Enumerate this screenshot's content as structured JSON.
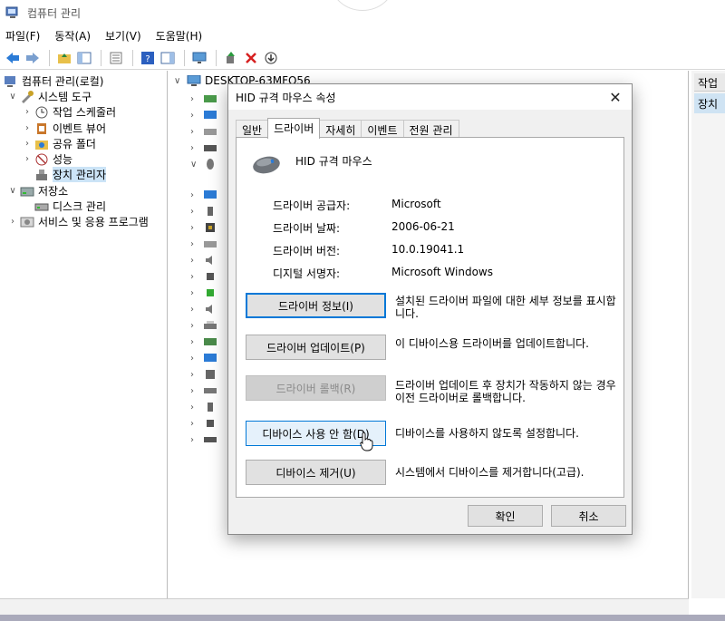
{
  "window": {
    "title": "컴퓨터 관리"
  },
  "menu": [
    "파일(F)",
    "동작(A)",
    "보기(V)",
    "도움말(H)"
  ],
  "tree": {
    "root": "컴퓨터 관리(로컬)",
    "system_tools": "시스템 도구",
    "task_scheduler": "작업 스케줄러",
    "event_viewer": "이벤트 뷰어",
    "shared_folders": "공유 폴더",
    "performance": "성능",
    "device_manager": "장치 관리자",
    "storage": "저장소",
    "disk_management": "디스크 관리",
    "services": "서비스 및 응용 프로그램"
  },
  "middle": {
    "computer_name": "DESKTOP-63MFO56"
  },
  "right_pane": {
    "header": "작업",
    "selected": "장치"
  },
  "dialog": {
    "title": "HID 규격 마우스 속성",
    "tabs": [
      "일반",
      "드라이버",
      "자세히",
      "이벤트",
      "전원 관리"
    ],
    "device_name": "HID 규격 마우스",
    "props": [
      {
        "label": "드라이버 공급자:",
        "value": "Microsoft"
      },
      {
        "label": "드라이버 날짜:",
        "value": "2006-06-21"
      },
      {
        "label": "드라이버 버전:",
        "value": "10.0.19041.1"
      },
      {
        "label": "디지털 서명자:",
        "value": "Microsoft Windows"
      }
    ],
    "actions": [
      {
        "label": "드라이버 정보(I)",
        "desc": "설치된 드라이버 파일에 대한 세부 정보를 표시합니다."
      },
      {
        "label": "드라이버 업데이트(P)",
        "desc": "이 디바이스용 드라이버를 업데이트합니다."
      },
      {
        "label": "드라이버 롤백(R)",
        "desc": "드라이버 업데이트 후 장치가 작동하지 않는 경우 이전 드라이버로 롤백합니다."
      },
      {
        "label": "디바이스 사용 안 함(D)",
        "desc": "디바이스를 사용하지 않도록 설정합니다."
      },
      {
        "label": "디바이스 제거(U)",
        "desc": "시스템에서 디바이스를 제거합니다(고급)."
      }
    ],
    "ok": "확인",
    "cancel": "취소"
  }
}
